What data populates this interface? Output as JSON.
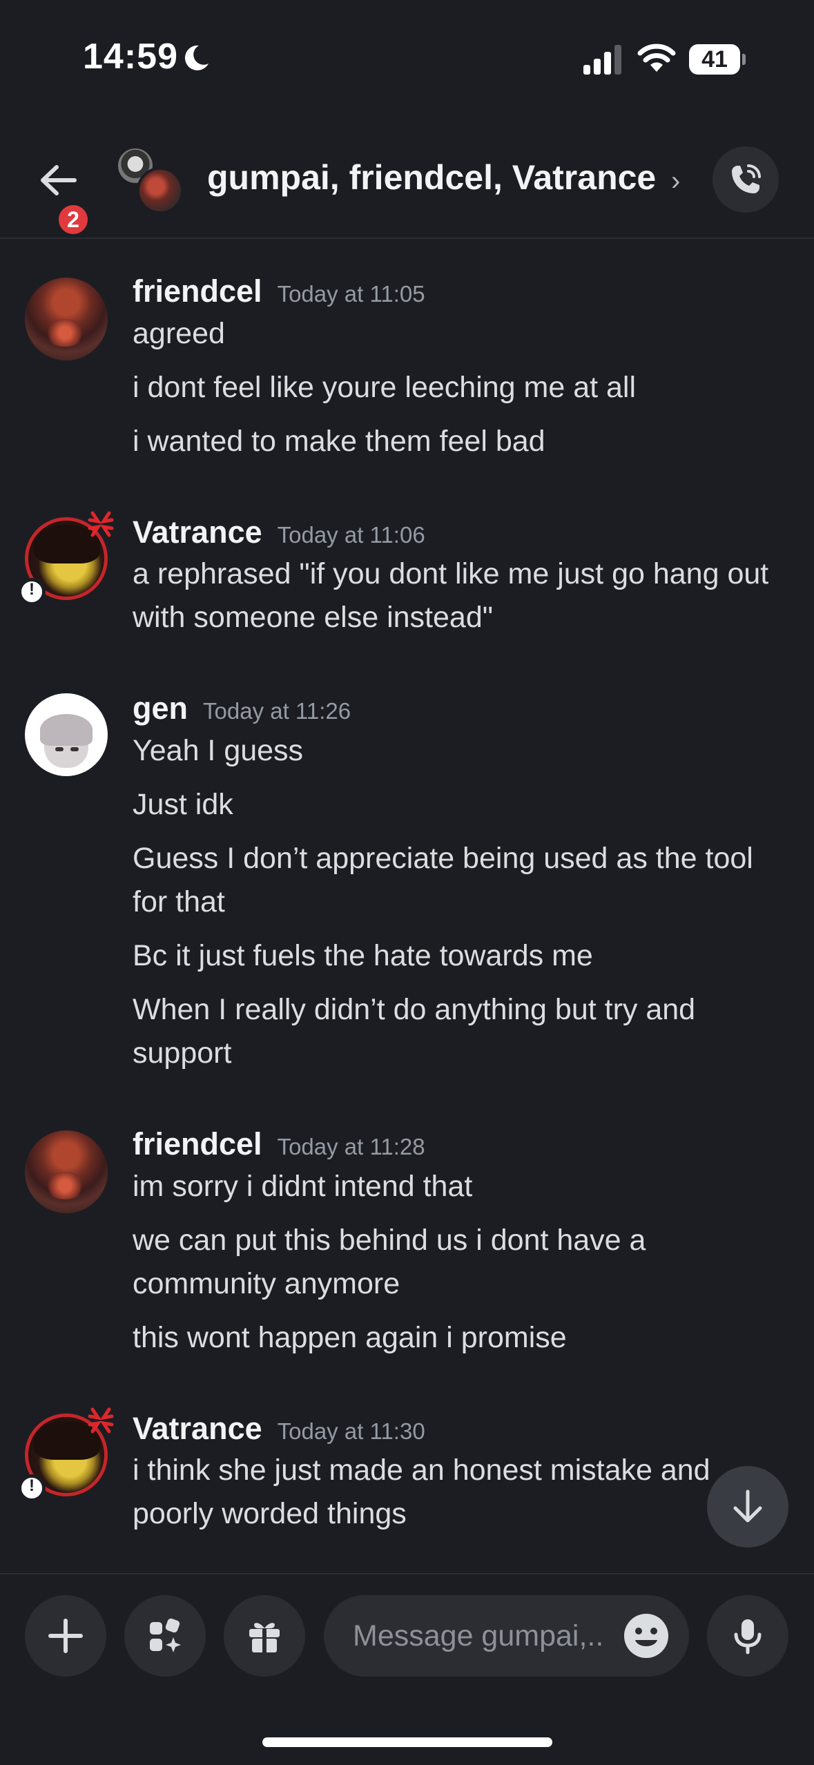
{
  "status_bar": {
    "time": "14:59",
    "battery_level": "41",
    "icons": [
      "moon-icon",
      "signal-icon",
      "wifi-icon",
      "battery-icon"
    ]
  },
  "header": {
    "badge_count": "2",
    "title": "gumpai, friendcel, Vatrance",
    "chevron": "›",
    "icons": [
      "back-arrow-icon",
      "call-icon"
    ]
  },
  "messages": [
    {
      "username": "friendcel",
      "timestamp": "Today at 11:05",
      "lines": [
        "agreed",
        "i dont feel like youre leeching me at all",
        "i wanted to make them feel bad"
      ]
    },
    {
      "username": "Vatrance",
      "timestamp": "Today at 11:06",
      "lines": [
        "a rephrased \"if you dont like me just go hang out with someone else instead\""
      ]
    },
    {
      "username": "gen",
      "timestamp": "Today at 11:26",
      "lines": [
        "Yeah I guess",
        "Just idk",
        "Guess I don’t appreciate being used as the tool for that",
        "Bc it just fuels the hate towards me",
        "When I really didn’t do anything but try and support"
      ]
    },
    {
      "username": "friendcel",
      "timestamp": "Today at 11:28",
      "lines": [
        "im sorry i didnt intend that",
        "we can put this behind us i dont have a community anymore",
        "this wont happen again i promise"
      ]
    },
    {
      "username": "Vatrance",
      "timestamp": "Today at 11:30",
      "lines": [
        "i think she just made an honest mistake and poorly worded things"
      ]
    }
  ],
  "composer": {
    "placeholder": "Message gumpai,..",
    "icons": [
      "plus-icon",
      "apps-icon",
      "gift-icon",
      "emoji-icon",
      "microphone-icon"
    ]
  },
  "colors": {
    "background": "#1c1d22",
    "surface": "#2b2d33",
    "badge": "#e03a3e",
    "text_primary": "#f2f3f5",
    "text_secondary": "#949ba4"
  }
}
